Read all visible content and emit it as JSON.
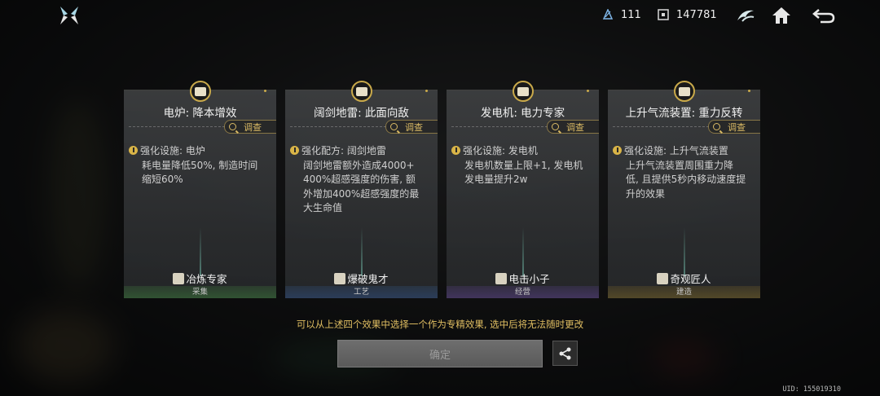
{
  "resources": [
    {
      "icon": "crystal-icon",
      "value": "111"
    },
    {
      "icon": "currency-icon",
      "value": "147781"
    }
  ],
  "cards": [
    {
      "title": "电炉: 降本增效",
      "inspect": "调查",
      "effect_lines": [
        "强化设施: 电炉",
        "耗电量降低50%, 制造时间",
        "缩短60%"
      ],
      "talent": "冶炼专家",
      "category": "采集",
      "category_color": "#3c783c"
    },
    {
      "title": "阔剑地雷: 此面向敌",
      "inspect": "调查",
      "effect_lines": [
        "强化配方: 阔剑地雷",
        "阔剑地雷额外造成4000+",
        "400%超感强度的伤害, 额",
        "外增加400%超感强度的最",
        "大生命值"
      ],
      "talent": "爆破鬼才",
      "category": "工艺",
      "category_color": "#325082"
    },
    {
      "title": "发电机: 电力专家",
      "inspect": "调查",
      "effect_lines": [
        "强化设施: 发电机",
        "发电机数量上限+1, 发电机",
        "发电量提升2w"
      ],
      "talent": "电击小子",
      "category": "经营",
      "category_color": "#5a4187"
    },
    {
      "title": "上升气流装置: 重力反转",
      "inspect": "调查",
      "effect_lines": [
        "强化设施: 上升气流装置",
        "上升气流装置周围重力降",
        "低, 且提供5秒内移动速度提",
        "升的效果"
      ],
      "talent": "奇观匠人",
      "category": "建造",
      "category_color": "#786428"
    }
  ],
  "hint": "可以从上述四个效果中选择一个作为专精效果, 选中后将无法随时更改",
  "confirm_label": "确定",
  "uid": "UID: 155019310",
  "colors": {
    "gold": "#d9b964",
    "hint": "#e1bf62"
  }
}
